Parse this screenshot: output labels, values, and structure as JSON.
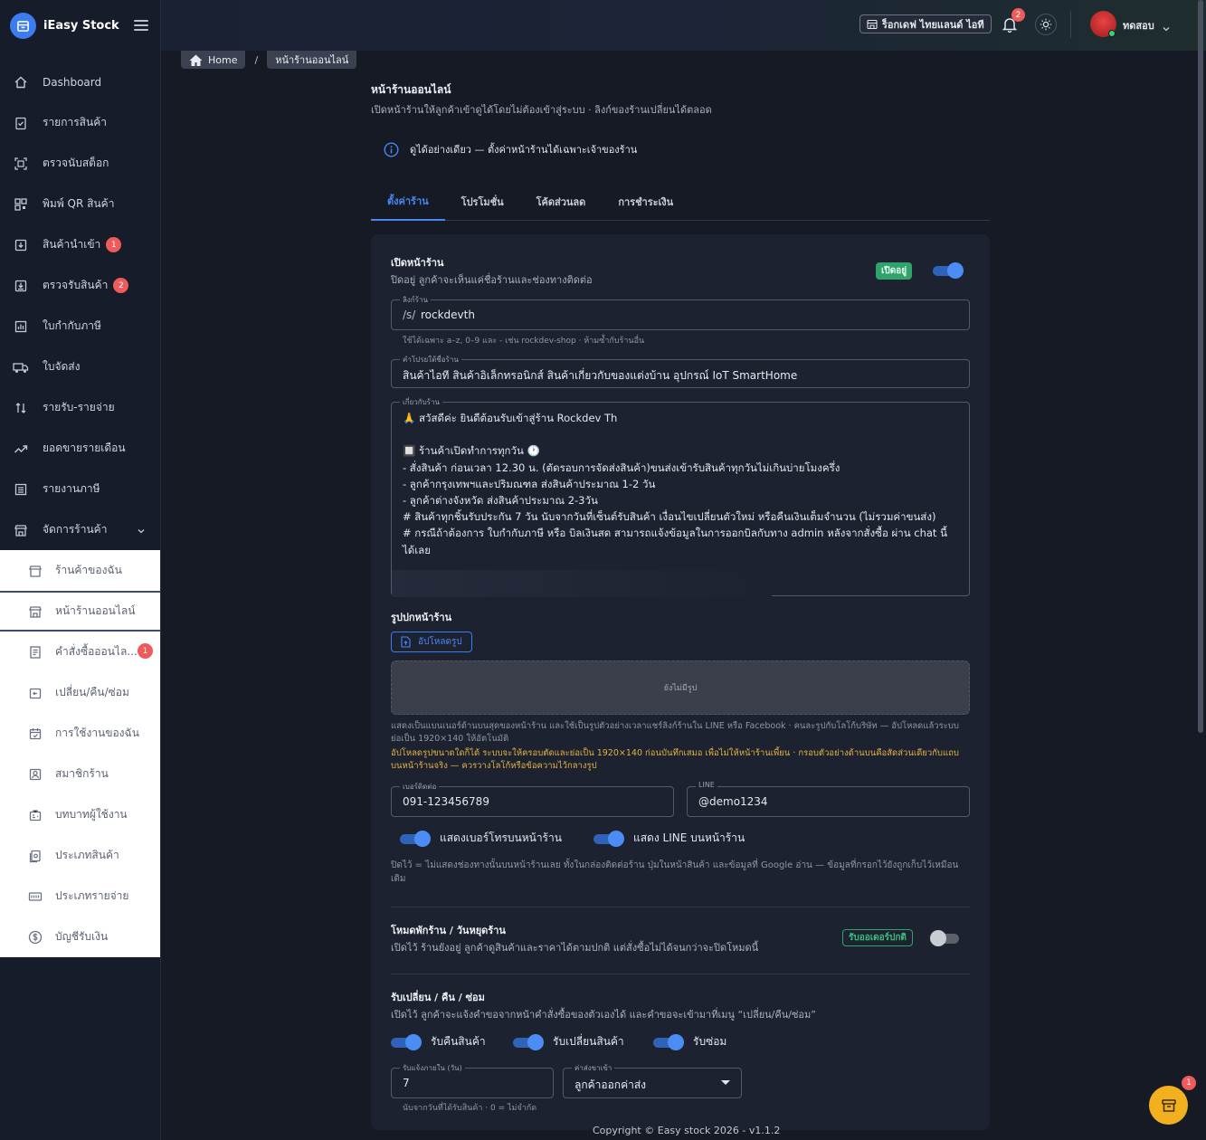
{
  "app": {
    "name": "iEasy Stock"
  },
  "sidebar": {
    "items": [
      {
        "label": "Dashboard",
        "icon": "home-icon"
      },
      {
        "label": "รายการสินค้า",
        "icon": "clipboard-check-icon"
      },
      {
        "label": "ตรวจนับสต็อก",
        "icon": "scan-icon"
      },
      {
        "label": "พิมพ์ QR สินค้า",
        "icon": "qr-icon"
      },
      {
        "label": "สินค้านำเข้า",
        "icon": "import-icon",
        "badge": "1"
      },
      {
        "label": "ตรวจรับสินค้า",
        "icon": "receive-icon",
        "badge": "2"
      },
      {
        "label": "ใบกำกับภาษี",
        "icon": "chart-doc-icon"
      },
      {
        "label": "ใบจัดส่ง",
        "icon": "truck-icon"
      },
      {
        "label": "รายรับ-รายจ่าย",
        "icon": "arrows-icon"
      },
      {
        "label": "ยอดขายรายเดือน",
        "icon": "trend-icon"
      },
      {
        "label": "รายงานภาษี",
        "icon": "list-icon"
      },
      {
        "label": "จัดการร้านค้า",
        "icon": "store-icon"
      }
    ],
    "sub_items": [
      {
        "label": "ร้านค้าของฉัน",
        "icon": "shop-icon"
      },
      {
        "label": "หน้าร้านออนไลน์",
        "icon": "storefront-icon"
      },
      {
        "label": "คำสั่งซื้อออนไล...",
        "icon": "order-icon",
        "badge": "1"
      },
      {
        "label": "เปลี่ยน/คืน/ซ่อม",
        "icon": "return-icon"
      },
      {
        "label": "การใช้งานของฉัน",
        "icon": "calendar-icon"
      },
      {
        "label": "สมาชิกร้าน",
        "icon": "member-icon"
      },
      {
        "label": "บทบาทผู้ใช้งาน",
        "icon": "role-icon"
      },
      {
        "label": "ประเภทสินค้า",
        "icon": "category-icon"
      },
      {
        "label": "ประเภทรายจ่าย",
        "icon": "expense-icon"
      },
      {
        "label": "บัญชีรับเงิน",
        "icon": "money-icon"
      }
    ]
  },
  "topbar": {
    "store_name": "ร็อกเดฟ ไทยแลนด์ ไอที",
    "notifications": "2",
    "user_name": "ทดสอบ"
  },
  "breadcrumb": {
    "home": "Home",
    "current": "หน้าร้านออนไลน์"
  },
  "page": {
    "title": "หน้าร้านออนไลน์",
    "subtitle": "เปิดหน้าร้านให้ลูกค้าเข้าดูได้โดยไม่ต้องเข้าสู่ระบบ · ลิงก์ของร้านเปลี่ยนได้ตลอด",
    "info": "ดูได้อย่างเดียว — ตั้งค่าหน้าร้านได้เฉพาะเจ้าของร้าน"
  },
  "tabs": [
    "ตั้งค่าร้าน",
    "โปรโมชั่น",
    "โค้ดส่วนลด",
    "การชำระเงิน"
  ],
  "storefront": {
    "title": "เปิดหน้าร้าน",
    "subtitle": "ปิดอยู่ ลูกค้าจะเห็นแค่ชื่อร้านและช่องทางติดต่อ",
    "status": "เปิดอยู่",
    "open": true,
    "link_label": "ลิงก์ร้าน",
    "link_prefix": "/s/",
    "link_value": "rockdevth",
    "link_helper": "ใช้ได้เฉพาะ a–z, 0–9 และ - เช่น rockdev-shop · ห้ามซ้ำกับร้านอื่น",
    "tagline_label": "คำโปรยใต้ชื่อร้าน",
    "tagline_value": "สินค้าไอที สินค้าอิเล็กทรอนิกส์ สินค้าเกี่ยวกับของแต่งบ้าน อุปกรณ์ IoT SmartHome",
    "about_label": "เกี่ยวกับร้าน",
    "about_value": "🙏 สวัสดีค่ะ ยินดีต้อนรับเข้าสู่ร้าน Rockdev Th\n\n🔲 ร้านค้าเปิดทำการทุกวัน 🕐\n- สั่งสินค้า ก่อนเวลา 12.30 น. (ตัดรอบการจัดส่งสินค้า)ขนส่งเข้ารับสินค้าทุกวันไม่เกินบ่ายโมงครึ่ง\n- ลูกค้ากรุงเทพฯและปริมณฑล ส่งสินค้าประมาณ 1-2 วัน\n- ลูกค้าต่างจังหวัด ส่งสินค้าประมาณ 2-3วัน\n# สินค้าทุกชิ้นรับประกัน 7 วัน นับจากวันที่เซ็นต์รับสินค้า เงื่อนไขเปลี่ยนตัวใหม่ หรือคืนเงินเต็มจำนวน (ไม่รวมค่าขนส่ง)\n# กรณีถ้าต้องการ ใบกำกับภาษี หรือ บิลเงินสด สามารถแจ้งข้อมูลในการออกบิลกับทาง admin หลังจากสั่งซื้อ ผ่าน chat นี้ได้เลย"
  },
  "cover": {
    "title": "รูปปกหน้าร้าน",
    "upload_label": "อัปโหลดรูป",
    "placeholder": "ยังไม่มีรูป",
    "note": "แสดงเป็นแบนเนอร์ด้านบนสุดของหน้าร้าน และใช้เป็นรูปตัวอย่างเวลาแชร์ลิงก์ร้านใน LINE หรือ Facebook · คนละรูปกับโลโก้บริษัท — อัปโหลดแล้วระบบย่อเป็น 1920×140 ให้อัตโนมัติ",
    "warning": "อัปโหลดรูปขนาดใดก็ได้ ระบบจะให้ครอบตัดและย่อเป็น 1920×140 ก่อนบันทึกเสมอ เพื่อไม่ให้หน้าร้านเพี้ยน · กรอบตัวอย่างด้านบนคือสัดส่วนเดียวกับแถบบนหน้าร้านจริง — ควรวางโลโก้หรือข้อความไว้กลางรูป"
  },
  "contact": {
    "phone_label": "เบอร์ติดต่อ",
    "phone_value": "091-123456789",
    "line_label": "LINE",
    "line_value": "@demo1234",
    "show_phone_label": "แสดงเบอร์โทรบนหน้าร้าน",
    "show_line_label": "แสดง LINE บนหน้าร้าน",
    "note": "ปิดไว้ = ไม่แสดงช่องทางนั้นบนหน้าร้านเลย ทั้งในกล่องติดต่อร้าน ปุ่มในหน้าสินค้า และข้อมูลที่ Google อ่าน — ข้อมูลที่กรอกไว้ยังถูกเก็บไว้เหมือนเดิม"
  },
  "vacation": {
    "title": "โหมดพักร้าน / วันหยุดร้าน",
    "subtitle": "เปิดไว้ ร้านยังอยู่ ลูกค้าดูสินค้าและราคาได้ตามปกติ แต่สั่งซื้อไม่ได้จนกว่าจะปิดโหมดนี้",
    "status": "รับออเดอร์ปกติ",
    "enabled": false
  },
  "returns": {
    "title": "รับเปลี่ยน / คืน / ซ่อม",
    "subtitle": "เปิดไว้ ลูกค้าจะแจ้งคำขอจากหน้าคำสั่งซื้อของตัวเองได้ และคำขอจะเข้ามาที่เมนู “เปลี่ยน/คืน/ซ่อม”",
    "accept_return": "รับคืนสินค้า",
    "accept_exchange": "รับเปลี่ยนสินค้า",
    "accept_repair": "รับซ่อม",
    "days_label": "รับแจ้งภายใน (วัน)",
    "days_value": "7",
    "days_helper": "นับจากวันที่ได้รับสินค้า · 0 = ไม่จำกัด",
    "shipping_label": "ค่าส่งขาเข้า",
    "shipping_value": "ลูกค้าออกค่าส่ง"
  },
  "footer": {
    "copyright": "Copyright © Easy stock 2026 - v1.1.2"
  },
  "fab": {
    "badge": "1"
  },
  "colors": {
    "accent": "#3d7cf0",
    "success": "#2fa36b",
    "danger": "#ef5a5a",
    "fab": "#f2b01e"
  }
}
